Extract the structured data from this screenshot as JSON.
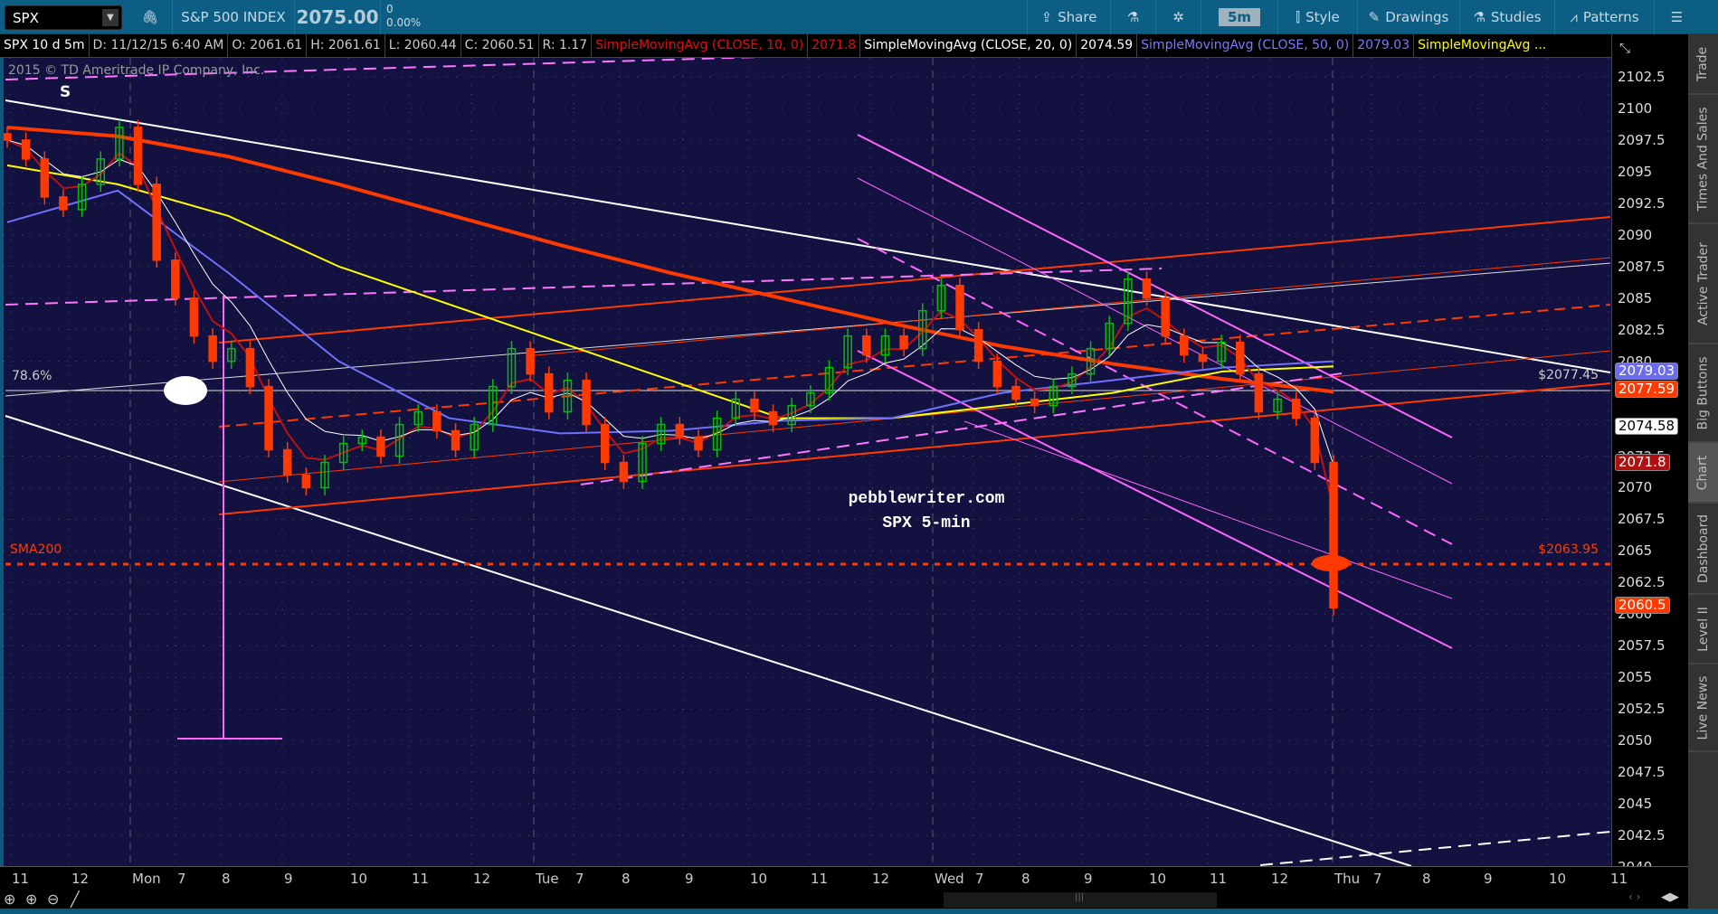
{
  "toolbar": {
    "symbol": "SPX",
    "index_name": "S&P 500 INDEX",
    "last": "2075.00",
    "change": "0",
    "change_pct": "0.00%",
    "share": "Share",
    "timeframe": "5m",
    "style": "Style",
    "drawings": "Drawings",
    "studies": "Studies",
    "patterns": "Patterns"
  },
  "infobar": {
    "desc": "SPX 10 d 5m",
    "date": "D: 11/12/15 6:40 AM",
    "open": "O: 2061.61",
    "high": "H: 2061.61",
    "low": "L: 2060.44",
    "close": "C: 2060.51",
    "range": "R: 1.17",
    "sma10_label": "SimpleMovingAvg (CLOSE, 10, 0)",
    "sma10_val": "2071.8",
    "sma20_label": "SimpleMovingAvg (CLOSE, 20, 0)",
    "sma20_val": "2074.59",
    "sma50_label": "SimpleMovingAvg (CLOSE, 50, 0)",
    "sma50_val": "2079.03",
    "sma_more_label": "SimpleMovingAvg ..."
  },
  "chart": {
    "copyright": "2015 © TD Ameritrade IP Company, Inc.",
    "marker_s": "S",
    "fib_label": "78.6%",
    "sma200_label": "SMA200",
    "level_1": "$2077.45",
    "level_2": "$2063.95",
    "watermark_1": "pebblewriter.com",
    "watermark_2": "SPX 5-min"
  },
  "badges": {
    "sma50": "2079.03",
    "sma200": "2077.59",
    "sma20": "2074.58",
    "sma10": "2071.8",
    "last": "2060.5"
  },
  "colors": {
    "background": "#13113f",
    "up": "#00c000",
    "down": "#ff3a00",
    "sma10": "#c01010",
    "sma20": "#ffffff",
    "sma50": "#7070ff",
    "sma_yellow": "#ffff00",
    "sma200": "#ff3a00",
    "drawing_pink": "#ff66ff"
  },
  "side_tabs": [
    "Trade",
    "Times And Sales",
    "Active Trader",
    "Big Buttons",
    "Chart",
    "Dashboard",
    "Level II",
    "Live News"
  ],
  "active_side_tab": "Chart",
  "chart_data": {
    "type": "candlestick",
    "ylim": [
      2040,
      2102.5
    ],
    "y_ticks": [
      "2102.5",
      "2100",
      "2097.5",
      "2095",
      "2092.5",
      "2090",
      "2087.5",
      "2085",
      "2082.5",
      "2080",
      "2077.5",
      "2075",
      "2072.5",
      "2070",
      "2067.5",
      "2065",
      "2062.5",
      "2060",
      "2057.5",
      "2055",
      "2052.5",
      "2050",
      "2047.5",
      "2045",
      "2042.5",
      "2040"
    ],
    "x_ticks": [
      "11",
      "12",
      "Mon",
      "7",
      "8",
      "9",
      "10",
      "11",
      "12",
      "Tue",
      "7",
      "8",
      "9",
      "10",
      "11",
      "12",
      "Wed",
      "7",
      "8",
      "9",
      "10",
      "11",
      "12",
      "Thu",
      "7",
      "8",
      "9",
      "10",
      "11"
    ],
    "closes": [
      2097.5,
      2096,
      2093,
      2092,
      2094,
      2096,
      2098.5,
      2094,
      2088,
      2085,
      2082,
      2080,
      2081,
      2078,
      2073,
      2071,
      2070,
      2072,
      2073.5,
      2074,
      2072.5,
      2075,
      2076,
      2074.5,
      2073,
      2075,
      2078,
      2081,
      2079,
      2076,
      2078.5,
      2075,
      2072,
      2070.5,
      2073.5,
      2075,
      2074,
      2073,
      2075.5,
      2077,
      2076,
      2075,
      2076.5,
      2077.5,
      2079.5,
      2082,
      2080.5,
      2082,
      2081,
      2084,
      2086,
      2082.5,
      2080,
      2078,
      2077,
      2076.5,
      2078,
      2079,
      2081,
      2083,
      2086.5,
      2085,
      2082,
      2080.5,
      2080,
      2081.5,
      2079,
      2076,
      2077,
      2075.5,
      2072,
      2060.5
    ],
    "sma200": [
      2098.5,
      2097.8,
      2096.2,
      2094,
      2091.6,
      2089.2,
      2087,
      2085,
      2083,
      2081.2,
      2079.8,
      2078.6,
      2077.6
    ],
    "sma_yellow": [
      2095.5,
      2094,
      2091.5,
      2087.5,
      2084.5,
      2081.5,
      2078.5,
      2075.5,
      2075.5,
      2076.5,
      2077.5,
      2079.2,
      2079.6
    ],
    "sma50": [
      2091,
      2093.5,
      2087,
      2080,
      2075.5,
      2074.3,
      2074.5,
      2075.3,
      2075.5,
      2077.5,
      2078.5,
      2079.5,
      2080
    ],
    "horizontal_levels": [
      2077.45,
      2063.95
    ]
  }
}
